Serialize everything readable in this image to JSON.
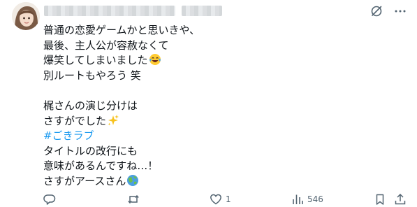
{
  "post": {
    "lines": [
      "普通の恋愛ゲームかと思いきや、",
      "最後、主人公が容赦なくて",
      "爆笑してしまいました",
      "別ルートもやろう 笑",
      "",
      "梶さんの演じ分けは",
      "さすがでした",
      "#ごきラブ",
      "タイトルの改行にも",
      "意味があるんですね…！",
      "さすがアースさん"
    ],
    "emojis": {
      "line3": "laughing-tears-emoji",
      "line7": "sparkles-emoji",
      "line11": "globe-emoji"
    }
  },
  "header_icons": [
    "grok-icon",
    "more-icon"
  ],
  "actions": {
    "reply": {
      "icon": "reply-icon",
      "count": ""
    },
    "repost": {
      "icon": "repost-icon",
      "count": ""
    },
    "like": {
      "icon": "heart-icon",
      "count": "1"
    },
    "views": {
      "icon": "views-icon",
      "count": "546"
    },
    "bookmark": {
      "icon": "bookmark-icon",
      "count": ""
    },
    "share": {
      "icon": "share-icon",
      "count": ""
    }
  },
  "colors": {
    "text": "#0f1419",
    "muted": "#536471",
    "hashtag": "#1d9bf0"
  }
}
